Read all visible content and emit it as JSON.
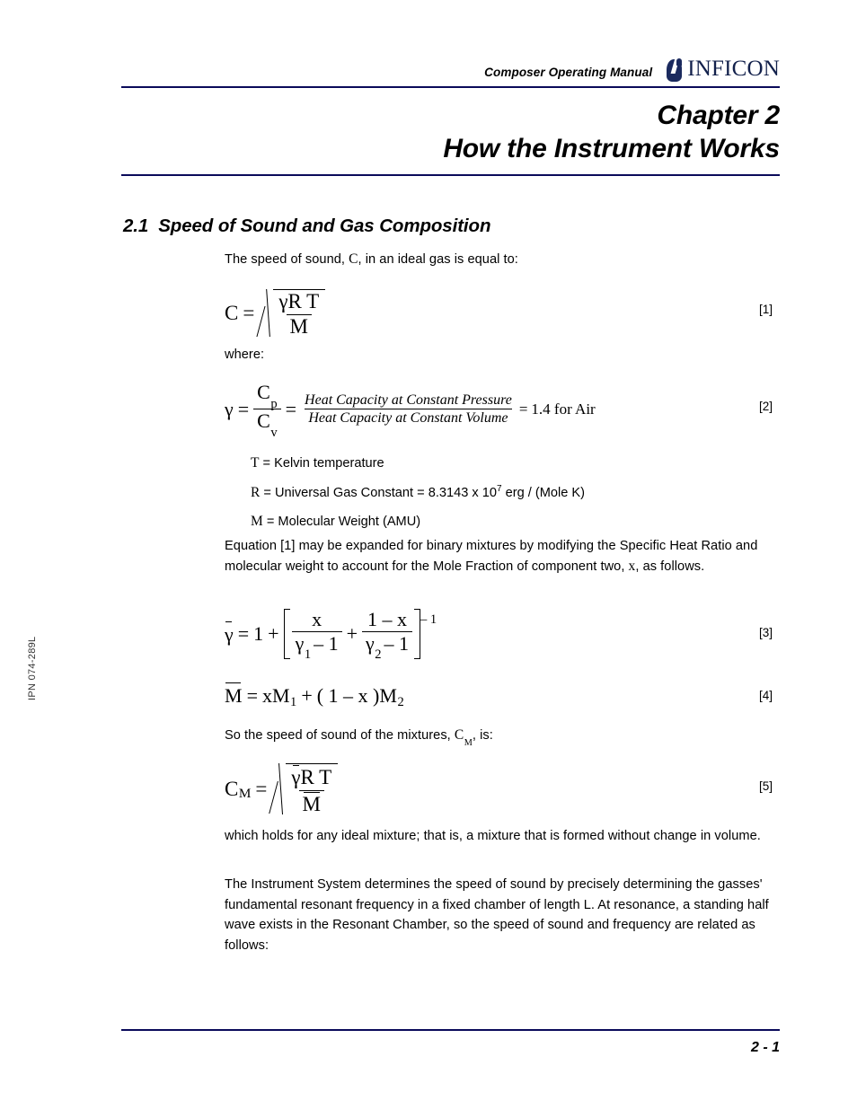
{
  "header": {
    "manual_title": "Composer Operating Manual",
    "brand": "INFICON",
    "rule_color": "#0a0a5a"
  },
  "chapter": {
    "number_line": "Chapter 2",
    "title_line": "How the Instrument Works"
  },
  "section": {
    "number": "2.1",
    "title": "Speed of Sound and Gas Composition"
  },
  "paragraphs": {
    "intro_a": "The speed of sound, ",
    "intro_var": "C",
    "intro_b": ", in an ideal gas is equal to:",
    "where": "where:",
    "expand": "Equation [1] may be expanded for binary mixtures by modifying the Specific Heat Ratio and molecular weight to account for the Mole Fraction of component two, ",
    "expand_var": "x",
    "expand_end": ", as follows.",
    "so_a": "So the speed of sound of the mixtures, ",
    "so_var": "C",
    "so_var_sub": "M",
    "so_b": ", is:",
    "holds": "which holds for any ideal mixture; that is, a mixture that is formed without change in volume.",
    "system": "The Instrument System determines the speed of sound by precisely determining the gasses' fundamental resonant frequency in a fixed chamber of length L. At resonance, a standing half wave exists in the Resonant Chamber, so the speed of sound and frequency are related as follows:"
  },
  "definitions": [
    {
      "symbol": "T",
      "text": " = Kelvin temperature"
    },
    {
      "symbol": "R",
      "text_before": " = Universal Gas Constant = 8.3143 x 10",
      "exponent": "7",
      "text_after": " erg / (Mole K)"
    },
    {
      "symbol": "M",
      "text": " = Molecular Weight (AMU)"
    }
  ],
  "equations": {
    "eq1": {
      "number": "[1]",
      "lhs": "C",
      "eq": "=",
      "radicand_num": "γR T",
      "radicand_den": "M",
      "plain": "C = sqrt( γRT / M )"
    },
    "eq2": {
      "number": "[2]",
      "lhs": "γ",
      "eq1": "=",
      "frac1_num": "C",
      "frac1_num_sub": "p",
      "frac1_den": "C",
      "frac1_den_sub": "v",
      "eq2": "=",
      "frac2_num": "Heat Capacity at Constant Pressure",
      "frac2_den": "Heat Capacity at Constant Volume",
      "eq3": "=",
      "result": "1.4 for Air",
      "plain": "γ = Cp/Cv = (Heat Capacity at Constant Pressure)/(Heat Capacity at Constant Volume) = 1.4 for Air"
    },
    "eq3": {
      "number": "[3]",
      "lhs": "γ",
      "eq": "=",
      "one": "1",
      "plus": "+",
      "t1_num": "x",
      "t1_den_g": "γ",
      "t1_den_sub": "1",
      "t1_den_rest": "– 1",
      "inner_plus": "+",
      "t2_num": "1 – x",
      "t2_den_g": "γ",
      "t2_den_sub": "2",
      "t2_den_rest": "– 1",
      "exponent": "– 1",
      "plain": "γ̄ = 1 + [ x/(γ₁–1) + (1–x)/(γ₂–1) ]^–1"
    },
    "eq4": {
      "number": "[4]",
      "lhs": "M",
      "eq": "=",
      "rhs_a": "xM",
      "rhs_a_sub": "1",
      "rhs_plus": "+",
      "rhs_b": "( 1 – x )M",
      "rhs_b_sub": "2",
      "plain": "M̄ = xM₁ + (1–x)M₂"
    },
    "eq5": {
      "number": "[5]",
      "lhs": "C",
      "lhs_sub": "M",
      "eq": "=",
      "radicand_num_g": "γ",
      "radicand_num_rest": "R T",
      "radicand_den": "M",
      "plain": "C_M = sqrt( γ̄RT / M̄ )"
    }
  },
  "side_code": "IPN 074-289L",
  "footer": {
    "page_number": "2 - 1"
  }
}
